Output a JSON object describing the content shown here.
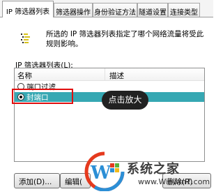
{
  "tabs": [
    {
      "label": "IP 筛选器列表",
      "active": true
    },
    {
      "label": "筛选器操作",
      "active": false
    },
    {
      "label": "身份验证方法",
      "active": false
    },
    {
      "label": "隧道设置",
      "active": false
    },
    {
      "label": "连接类型",
      "active": false
    }
  ],
  "description": "所选的 IP 筛选器列表指定了哪个网络流量将受此规则影响。",
  "list": {
    "label": "IP 筛选器列表(L):",
    "columns": {
      "name": "名称",
      "description": "描述"
    },
    "rows": [
      {
        "name": "端口过滤",
        "selected": false
      },
      {
        "name": "封端口",
        "selected": true
      }
    ]
  },
  "tooltip": "点击放大",
  "buttons": {
    "add": "添加(D)...",
    "edit": "编辑(",
    "delete": "删除(R)"
  },
  "watermark": {
    "brand": "系统之家",
    "url": "www.Winwin7.com"
  },
  "colors": {
    "selection": "#36a8b3",
    "highlight_border": "#e10e0e",
    "tooltip_bg": "#222222"
  }
}
